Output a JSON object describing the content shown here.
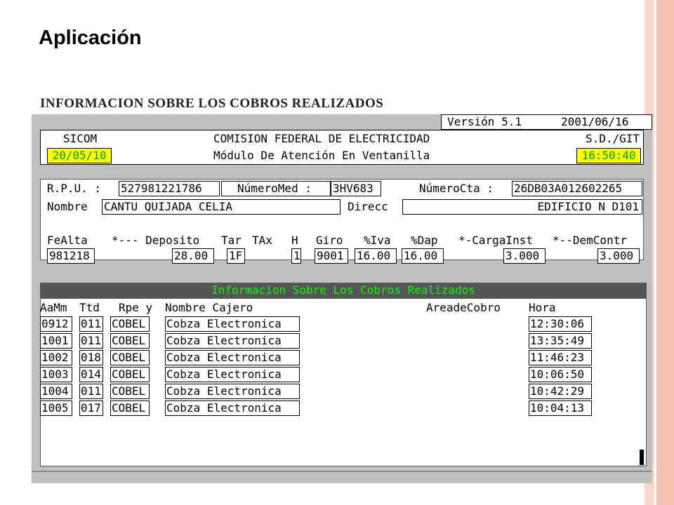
{
  "slide": {
    "title": "Aplicación",
    "subtitle": "INFORMACION SOBRE LOS COBROS REALIZADOS"
  },
  "colors": {
    "stripe_light": "#f7d8cd",
    "stripe_mid": "#f3c1ae",
    "terminal_bg": "#c0c0c0",
    "highlight_bg": "#ffff00",
    "highlight_fg": "#00a000",
    "bar_bg": "#555555",
    "bar_fg": "#00ff00"
  },
  "terminal": {
    "version": "Versión 5.1",
    "version_date": "2001/06/16",
    "system": "SICOM",
    "org": "COMISION FEDERAL DE ELECTRICIDAD",
    "dept": "S.D./GIT",
    "date": "20/05/10",
    "module": "Módulo De Atención En Ventanilla",
    "time": "16:50:40"
  },
  "customer": {
    "rpu_label": "R.P.U. :",
    "rpu_value": "527981221786",
    "meter_label": "NúmeroMed :",
    "meter_value": "3HV683",
    "account_label": "NúmeroCta :",
    "account_value": "26DB03A012602265",
    "name_label": "Nombre",
    "name_value": "CANTU QUIJADA CELIA",
    "address_label": "Direcc",
    "address_value": "EDIFICIO N D101"
  },
  "tariff": {
    "headers": {
      "fealta": "FeAlta",
      "deposito": "*--- Deposito",
      "tar": "Tar",
      "tax": "TAx",
      "h": "H",
      "giro": "Giro",
      "iva": "%Iva",
      "dap": "%Dap",
      "carga": "*-CargaInst",
      "demanda": "*--DemContr"
    },
    "values": {
      "fealta": "981218",
      "deposito": "28.00",
      "tar": "1F",
      "h": "1",
      "giro": "9001",
      "iva": "16.00",
      "dap": "16.00",
      "carga": "3.000",
      "demanda": "3.000"
    }
  },
  "payments": {
    "bar_title": "Informacion Sobre Los Cobros Realizados",
    "headers": {
      "aamm": "AaMm",
      "ttd": "Ttd",
      "rpe": "Rpe y",
      "nombre": "Nombre Cajero",
      "area": "AreadeCobro",
      "hora": "Hora"
    },
    "rows": [
      {
        "aamm": "0912",
        "ttd": "011",
        "rpe": "COBEL",
        "nombre": "Cobza Electronica",
        "hora": "12:30:06"
      },
      {
        "aamm": "1001",
        "ttd": "011",
        "rpe": "COBEL",
        "nombre": "Cobza Electronica",
        "hora": "13:35:49"
      },
      {
        "aamm": "1002",
        "ttd": "018",
        "rpe": "COBEL",
        "nombre": "Cobza Electronica",
        "hora": "11:46:23"
      },
      {
        "aamm": "1003",
        "ttd": "014",
        "rpe": "COBEL",
        "nombre": "Cobza Electronica",
        "hora": "10:06:50"
      },
      {
        "aamm": "1004",
        "ttd": "011",
        "rpe": "COBEL",
        "nombre": "Cobza Electronica",
        "hora": "10:42:29"
      },
      {
        "aamm": "1005",
        "ttd": "017",
        "rpe": "COBEL",
        "nombre": "Cobza Electronica",
        "hora": "10:04:13"
      }
    ]
  }
}
